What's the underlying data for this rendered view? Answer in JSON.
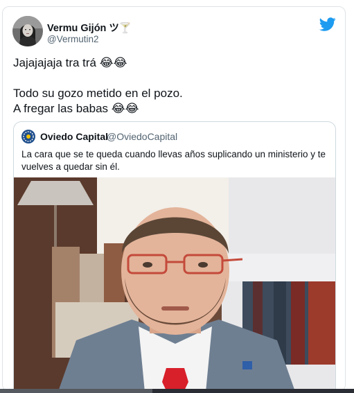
{
  "tweet": {
    "author": {
      "display_name": "Vermu Gijón ツ🍸",
      "handle": "@Vermutin2"
    },
    "brand_icon": "twitter-bird-icon",
    "text_lines": {
      "line1": "Jajajajaja tra trá 😂😂",
      "line2": "Todo su gozo metido en el pozo.",
      "line3": "A fregar las babas 😂😂"
    }
  },
  "quoted_tweet": {
    "author": {
      "display_name": "Oviedo Capital",
      "handle": "@OviedoCapital"
    },
    "text": "La cara que se te queda cuando llevas años suplicando un ministerio y te vuelves a quedar sin él.",
    "media": "photo-of-man-in-suit"
  },
  "colors": {
    "twitter_blue": "#1d9bf0",
    "text_primary": "#0f1419",
    "text_secondary": "#536471",
    "border": "#cfd9de"
  }
}
